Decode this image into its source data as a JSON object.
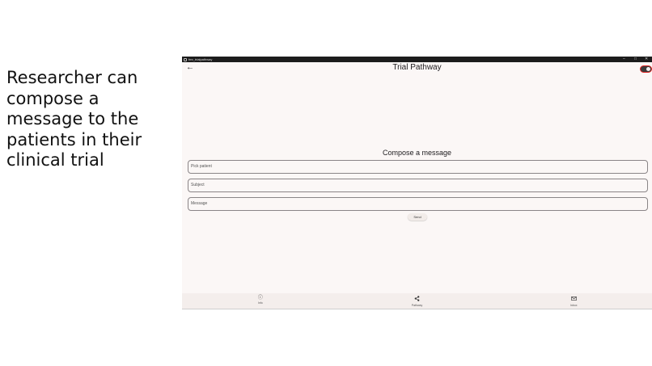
{
  "caption": "Researcher can compose a message to the patients in their clinical trial",
  "window": {
    "titlebar_title": "fmr_trialpathway",
    "app_title": "Trial Pathway"
  },
  "compose": {
    "heading": "Compose a message",
    "patient_placeholder": "Pick patient",
    "subject_placeholder": "Subject",
    "message_placeholder": "Message",
    "send_label": "Send"
  },
  "navbar": {
    "items": [
      {
        "label": "Info",
        "icon": "info-icon"
      },
      {
        "label": "Pathway",
        "icon": "share-icon"
      },
      {
        "label": "Inbox",
        "icon": "mail-icon"
      }
    ]
  },
  "colors": {
    "background": "#fbf7f6",
    "titlebar": "#1c1c1c",
    "navbar": "#f4eeec",
    "toggle_outline": "#dd2222"
  }
}
